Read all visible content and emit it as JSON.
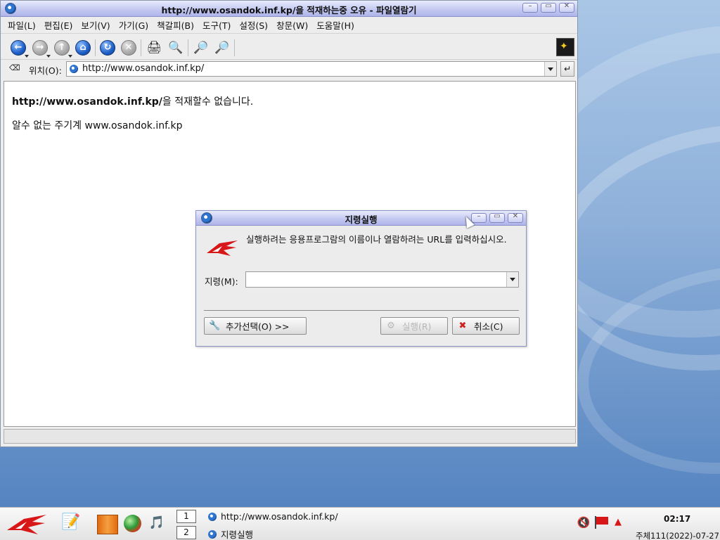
{
  "browser": {
    "title": "http://www.osandok.inf.kp/을 적재하는중 오유 - 파일열람기",
    "menu": [
      "파일(L)",
      "편집(E)",
      "보기(V)",
      "가기(G)",
      "책갈피(B)",
      "도구(T)",
      "설정(S)",
      "창문(W)",
      "도움말(H)"
    ],
    "toolbar_icons": [
      "back-icon",
      "forward-icon",
      "up-icon",
      "home-icon",
      "reload-icon",
      "stop-icon",
      "print-icon",
      "find-icon",
      "zoom-in-icon",
      "zoom-out-icon",
      "konqueror-icon"
    ],
    "location_label": "위치(O):",
    "location_value": "http://www.osandok.inf.kp/",
    "content": {
      "error_url": "http://www.osandok.inf.kp/",
      "error_suffix": "을 적재할수 없습니다.",
      "detail": "알수 없는 주기계 www.osandok.inf.kp"
    }
  },
  "dialog": {
    "title": "지령실행",
    "message": "실행하려는 응용프로그람의 이름이나 열람하려는 URL를 입력하십시오.",
    "command_label": "지령(M):",
    "command_value": "",
    "more_options_button": "추가선택(O) >>",
    "run_button": "실행(R)",
    "cancel_button": "취소(C)"
  },
  "taskbar": {
    "pager": [
      "1",
      "2"
    ],
    "tasks": [
      "http://www.osandok.inf.kp/",
      "지령실행"
    ],
    "clock": "02:17",
    "date": "주체111(2022)-07-27"
  },
  "colors": {
    "titlebar_top": "#e9ecfb",
    "titlebar_bottom": "#aeb4ea",
    "desktop_bottom": "#4f7fbd"
  }
}
